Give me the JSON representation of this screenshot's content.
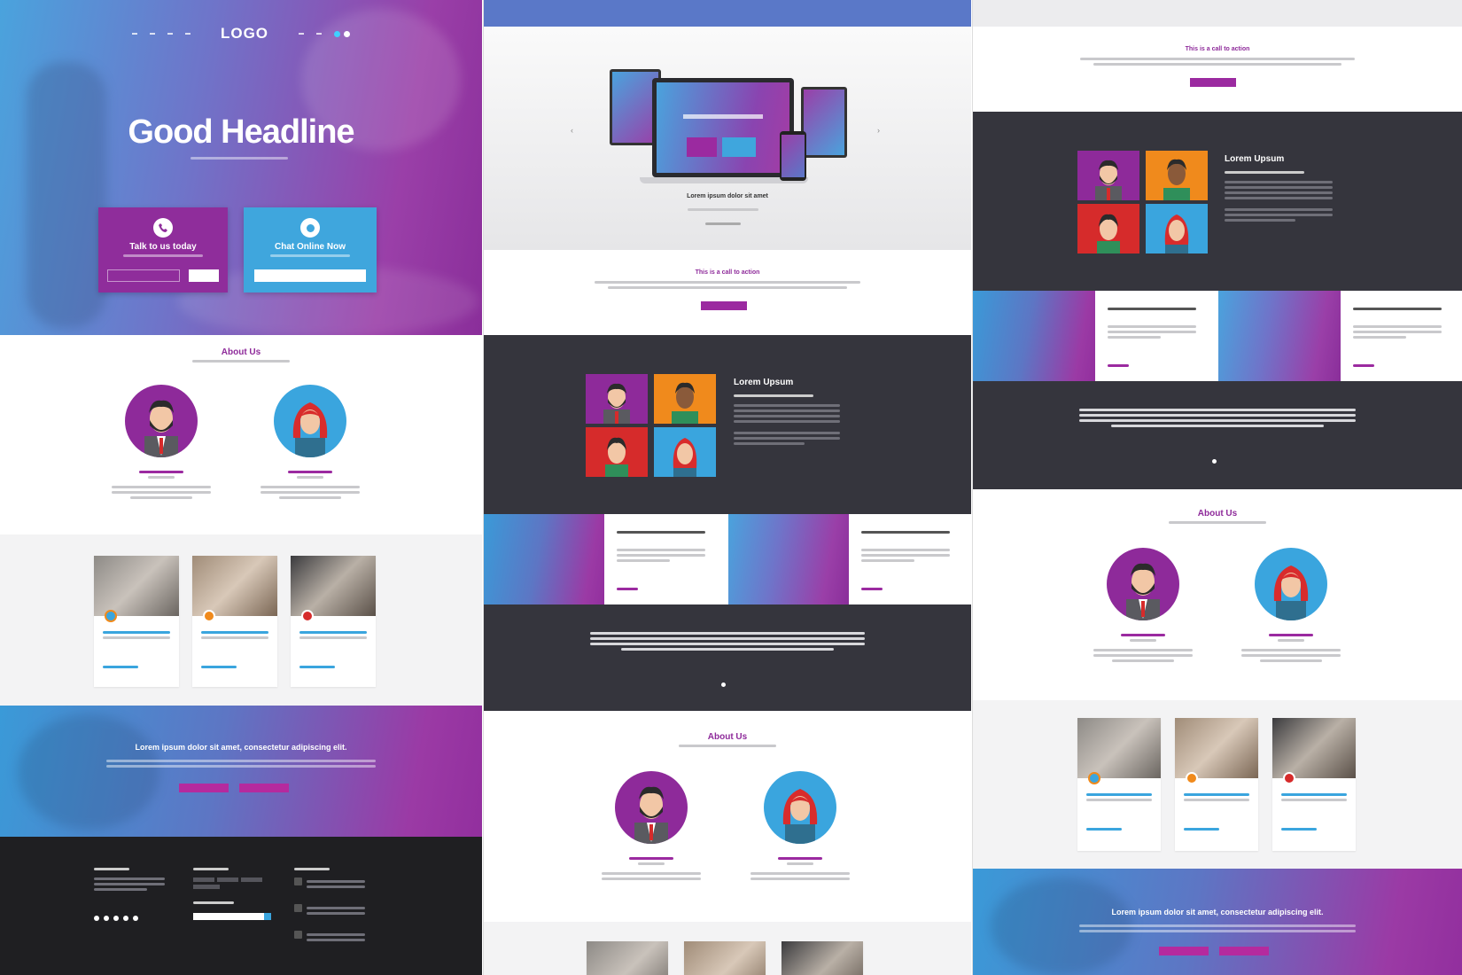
{
  "col1": {
    "logo": "LOGO",
    "hero_title": "Good Headline",
    "cta_call": "Talk to us today",
    "cta_chat": "Chat Online Now",
    "about_title": "About Us",
    "banner_title": "Lorem ipsum dolor sit amet, consectetur adipiscing elit."
  },
  "col2": {
    "device_caption": "Lorem ipsum dolor sit amet",
    "cta_title": "This is a call to action",
    "team_title": "Lorem Upsum",
    "about_title": "About Us"
  },
  "col3": {
    "cta_title": "This is a call to action",
    "team_title": "Lorem Upsum",
    "about_title": "About Us",
    "banner_title": "Lorem ipsum dolor sit amet, consectetur adipiscing elit."
  },
  "icons": [
    "phone-icon",
    "chat-icon",
    "arrow-left-icon",
    "arrow-right-icon",
    "social-icons"
  ],
  "colors": {
    "purple": "#9b2aa0",
    "blue": "#3fa3dc",
    "dark": "#35353d",
    "footer": "#1f1f22",
    "orange": "#f08a1c",
    "red": "#d62b2b"
  }
}
